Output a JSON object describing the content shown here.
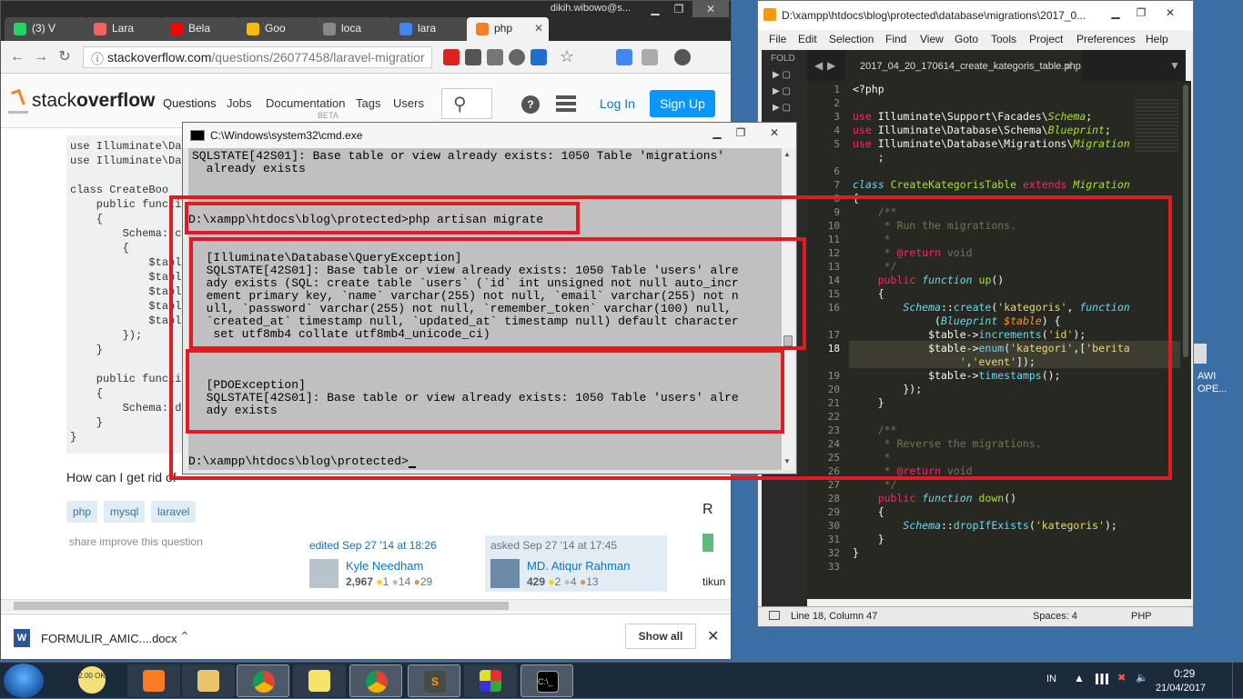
{
  "chrome": {
    "user": "dikih.wibowo@s...",
    "tabs": [
      {
        "label": "(3) V",
        "color": "#25d366"
      },
      {
        "label": "Lara",
        "color": "#f4645f"
      },
      {
        "label": "Bela",
        "color": "#ff0000"
      },
      {
        "label": "Goo",
        "color": "#fbbc05"
      },
      {
        "label": "loca",
        "color": "#888888"
      },
      {
        "label": "lara",
        "color": "#4285f4"
      },
      {
        "label": "php",
        "color": "#f48024"
      }
    ],
    "url_host": "stackoverflow.com",
    "url_path": "/questions/26077458/laravel-migratior",
    "downloads_file": "FORMULIR_AMIC....docx",
    "show_all": "Show all"
  },
  "so": {
    "logo_a": "stack",
    "logo_b": "overflow",
    "nav": [
      "Questions",
      "Jobs",
      "Documentation",
      "Tags",
      "Users"
    ],
    "beta": "BETA",
    "login": "Log In",
    "signup": "Sign Up",
    "code_lines": [
      "use Illuminate\\Da",
      "use Illuminate\\Da",
      "",
      "class CreateBoo",
      "    public functi",
      "    {",
      "        Schema::c",
      "        {",
      "            $tabl",
      "            $tabl",
      "            $tabl",
      "            $tabl",
      "            $tabl",
      "        });",
      "    }",
      "",
      "    public functi",
      "    {",
      "        Schema::d",
      "    }",
      "}"
    ],
    "question": "How can I get rid of",
    "tags": [
      "php",
      "mysql",
      "laravel"
    ],
    "share": "share  improve this question",
    "edited": {
      "when": "edited Sep 27 '14 at 18:26",
      "name": "Kyle Needham",
      "rep": "2,967",
      "gold": "1",
      "silver": "14",
      "bronze": "29"
    },
    "asked": {
      "when": "asked Sep 27 '14 at 17:45",
      "name": "MD. Atiqur Rahman",
      "rep": "429",
      "gold": "2",
      "silver": "4",
      "bronze": "13"
    }
  },
  "cmd": {
    "title": "C:\\Windows\\system32\\cmd.exe",
    "line_top": "SQLSTATE[42S01]: Base table or view already exists: 1050 Table 'migrations'\n  already exists",
    "prompt1": "D:\\xampp\\htdocs\\blog\\protected>php artisan migrate",
    "exception1": "  [Illuminate\\Database\\QueryException]\n  SQLSTATE[42S01]: Base table or view already exists: 1050 Table 'users' alre\n  ady exists (SQL: create table `users` (`id` int unsigned not null auto_incr\n  ement primary key, `name` varchar(255) not null, `email` varchar(255) not n\n  ull, `password` varchar(255) not null, `remember_token` varchar(100) null,\n  `created_at` timestamp null, `updated_at` timestamp null) default character\n   set utf8mb4 collate utf8mb4_unicode_ci)",
    "exception2": "  [PDOException]\n  SQLSTATE[42S01]: Base table or view already exists: 1050 Table 'users' alre\n  ady exists",
    "prompt2": "D:\\xampp\\htdocs\\blog\\protected>"
  },
  "sublime": {
    "title": "D:\\xampp\\htdocs\\blog\\protected\\database\\migrations\\2017_0...",
    "menu": [
      "File",
      "Edit",
      "Selection",
      "Find",
      "View",
      "Goto",
      "Tools",
      "Project",
      "Preferences",
      "Help"
    ],
    "folders_label": "FOLD",
    "tab": "2017_04_20_170614_create_kategoris_table.php",
    "line_numbers": [
      "1",
      "2",
      "3",
      "4",
      "5",
      "",
      "6",
      "7",
      "8",
      "9",
      "10",
      "11",
      "12",
      "13",
      "14",
      "15",
      "16",
      "",
      "17",
      "18",
      "",
      "19",
      "20",
      "21",
      "22",
      "23",
      "24",
      "25",
      "26",
      "27",
      "28",
      "29",
      "30",
      "31",
      "32",
      "33"
    ],
    "status_pos": "Line 18, Column 47",
    "status_spaces": "Spaces: 4",
    "status_syntax": "PHP"
  },
  "desktop": {
    "label1": "AWI",
    "label2": "OPE...",
    "snippet1": "R",
    "snippet2": "tikun"
  },
  "taskbar": {
    "lang": "IN",
    "time": "0:29",
    "date": "21/04/2017",
    "apps": [
      "ie",
      "xampp",
      "explorer",
      "chrome",
      "sticky-notes",
      "chrome-alt",
      "sublime",
      "git",
      "cmd"
    ],
    "badge": "2.00 OK"
  }
}
